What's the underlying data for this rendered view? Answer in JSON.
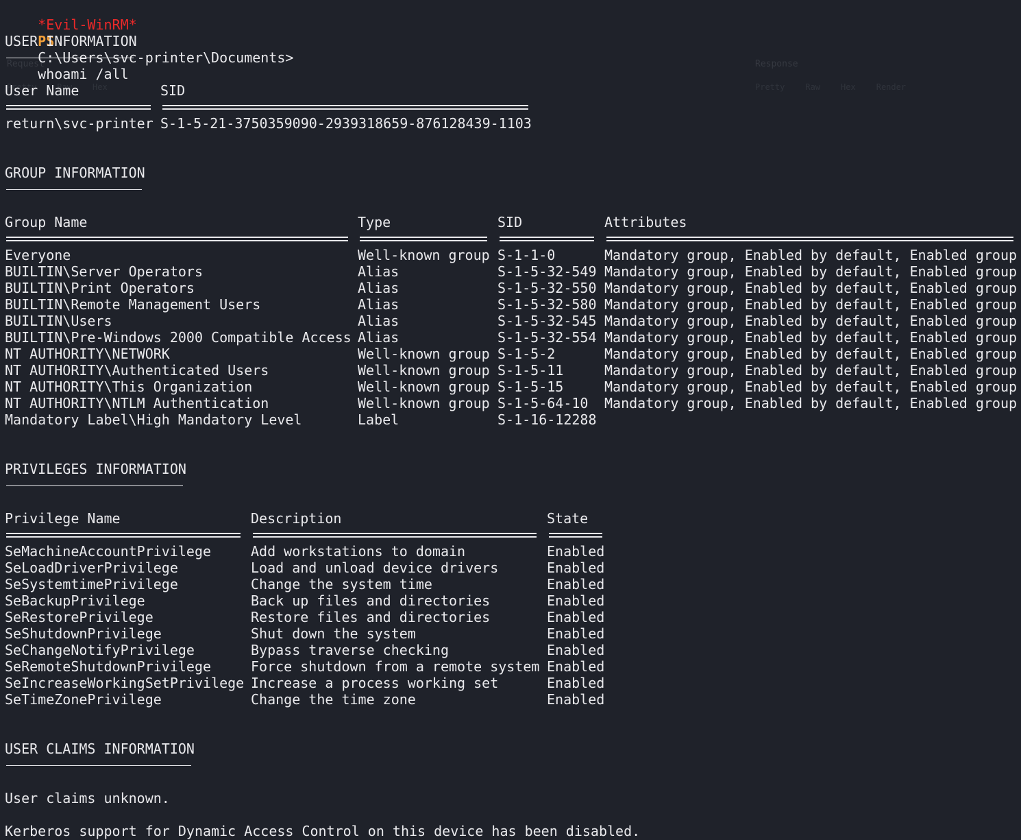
{
  "prompt": {
    "mode": "*Evil-WinRM*",
    "ps": "PS",
    "path": "C:\\Users\\svc-printer\\Documents>",
    "command": "whoami /all"
  },
  "user_info": {
    "heading": "USER INFORMATION",
    "columns": [
      "User Name",
      "SID"
    ],
    "rows": [
      [
        "return\\svc-printer",
        "S-1-5-21-3750359090-2939318659-876128439-1103"
      ]
    ]
  },
  "group_info": {
    "heading": "GROUP INFORMATION",
    "columns": [
      "Group Name",
      "Type",
      "SID",
      "Attributes"
    ],
    "rows": [
      [
        "Everyone",
        "Well-known group",
        "S-1-1-0",
        "Mandatory group, Enabled by default, Enabled group"
      ],
      [
        "BUILTIN\\Server Operators",
        "Alias",
        "S-1-5-32-549",
        "Mandatory group, Enabled by default, Enabled group"
      ],
      [
        "BUILTIN\\Print Operators",
        "Alias",
        "S-1-5-32-550",
        "Mandatory group, Enabled by default, Enabled group"
      ],
      [
        "BUILTIN\\Remote Management Users",
        "Alias",
        "S-1-5-32-580",
        "Mandatory group, Enabled by default, Enabled group"
      ],
      [
        "BUILTIN\\Users",
        "Alias",
        "S-1-5-32-545",
        "Mandatory group, Enabled by default, Enabled group"
      ],
      [
        "BUILTIN\\Pre-Windows 2000 Compatible Access",
        "Alias",
        "S-1-5-32-554",
        "Mandatory group, Enabled by default, Enabled group"
      ],
      [
        "NT AUTHORITY\\NETWORK",
        "Well-known group",
        "S-1-5-2",
        "Mandatory group, Enabled by default, Enabled group"
      ],
      [
        "NT AUTHORITY\\Authenticated Users",
        "Well-known group",
        "S-1-5-11",
        "Mandatory group, Enabled by default, Enabled group"
      ],
      [
        "NT AUTHORITY\\This Organization",
        "Well-known group",
        "S-1-5-15",
        "Mandatory group, Enabled by default, Enabled group"
      ],
      [
        "NT AUTHORITY\\NTLM Authentication",
        "Well-known group",
        "S-1-5-64-10",
        "Mandatory group, Enabled by default, Enabled group"
      ],
      [
        "Mandatory Label\\High Mandatory Level",
        "Label",
        "S-1-16-12288",
        ""
      ]
    ]
  },
  "privileges_info": {
    "heading": "PRIVILEGES INFORMATION",
    "columns": [
      "Privilege Name",
      "Description",
      "State"
    ],
    "rows": [
      [
        "SeMachineAccountPrivilege",
        "Add workstations to domain",
        "Enabled"
      ],
      [
        "SeLoadDriverPrivilege",
        "Load and unload device drivers",
        "Enabled"
      ],
      [
        "SeSystemtimePrivilege",
        "Change the system time",
        "Enabled"
      ],
      [
        "SeBackupPrivilege",
        "Back up files and directories",
        "Enabled"
      ],
      [
        "SeRestorePrivilege",
        "Restore files and directories",
        "Enabled"
      ],
      [
        "SeShutdownPrivilege",
        "Shut down the system",
        "Enabled"
      ],
      [
        "SeChangeNotifyPrivilege",
        "Bypass traverse checking",
        "Enabled"
      ],
      [
        "SeRemoteShutdownPrivilege",
        "Force shutdown from a remote system",
        "Enabled"
      ],
      [
        "SeIncreaseWorkingSetPrivilege",
        "Increase a process working set",
        "Enabled"
      ],
      [
        "SeTimeZonePrivilege",
        "Change the time zone",
        "Enabled"
      ]
    ]
  },
  "claims_info": {
    "heading": "USER CLAIMS INFORMATION",
    "line": "User claims unknown."
  },
  "kerberos_line": "Kerberos support for Dynamic Access Control on this device has been disabled.",
  "colors": {
    "background": "#1f222a",
    "text": "#e9e9ec",
    "prompt_mode": "#ec2929",
    "prompt_ps": "#f4a13a"
  }
}
